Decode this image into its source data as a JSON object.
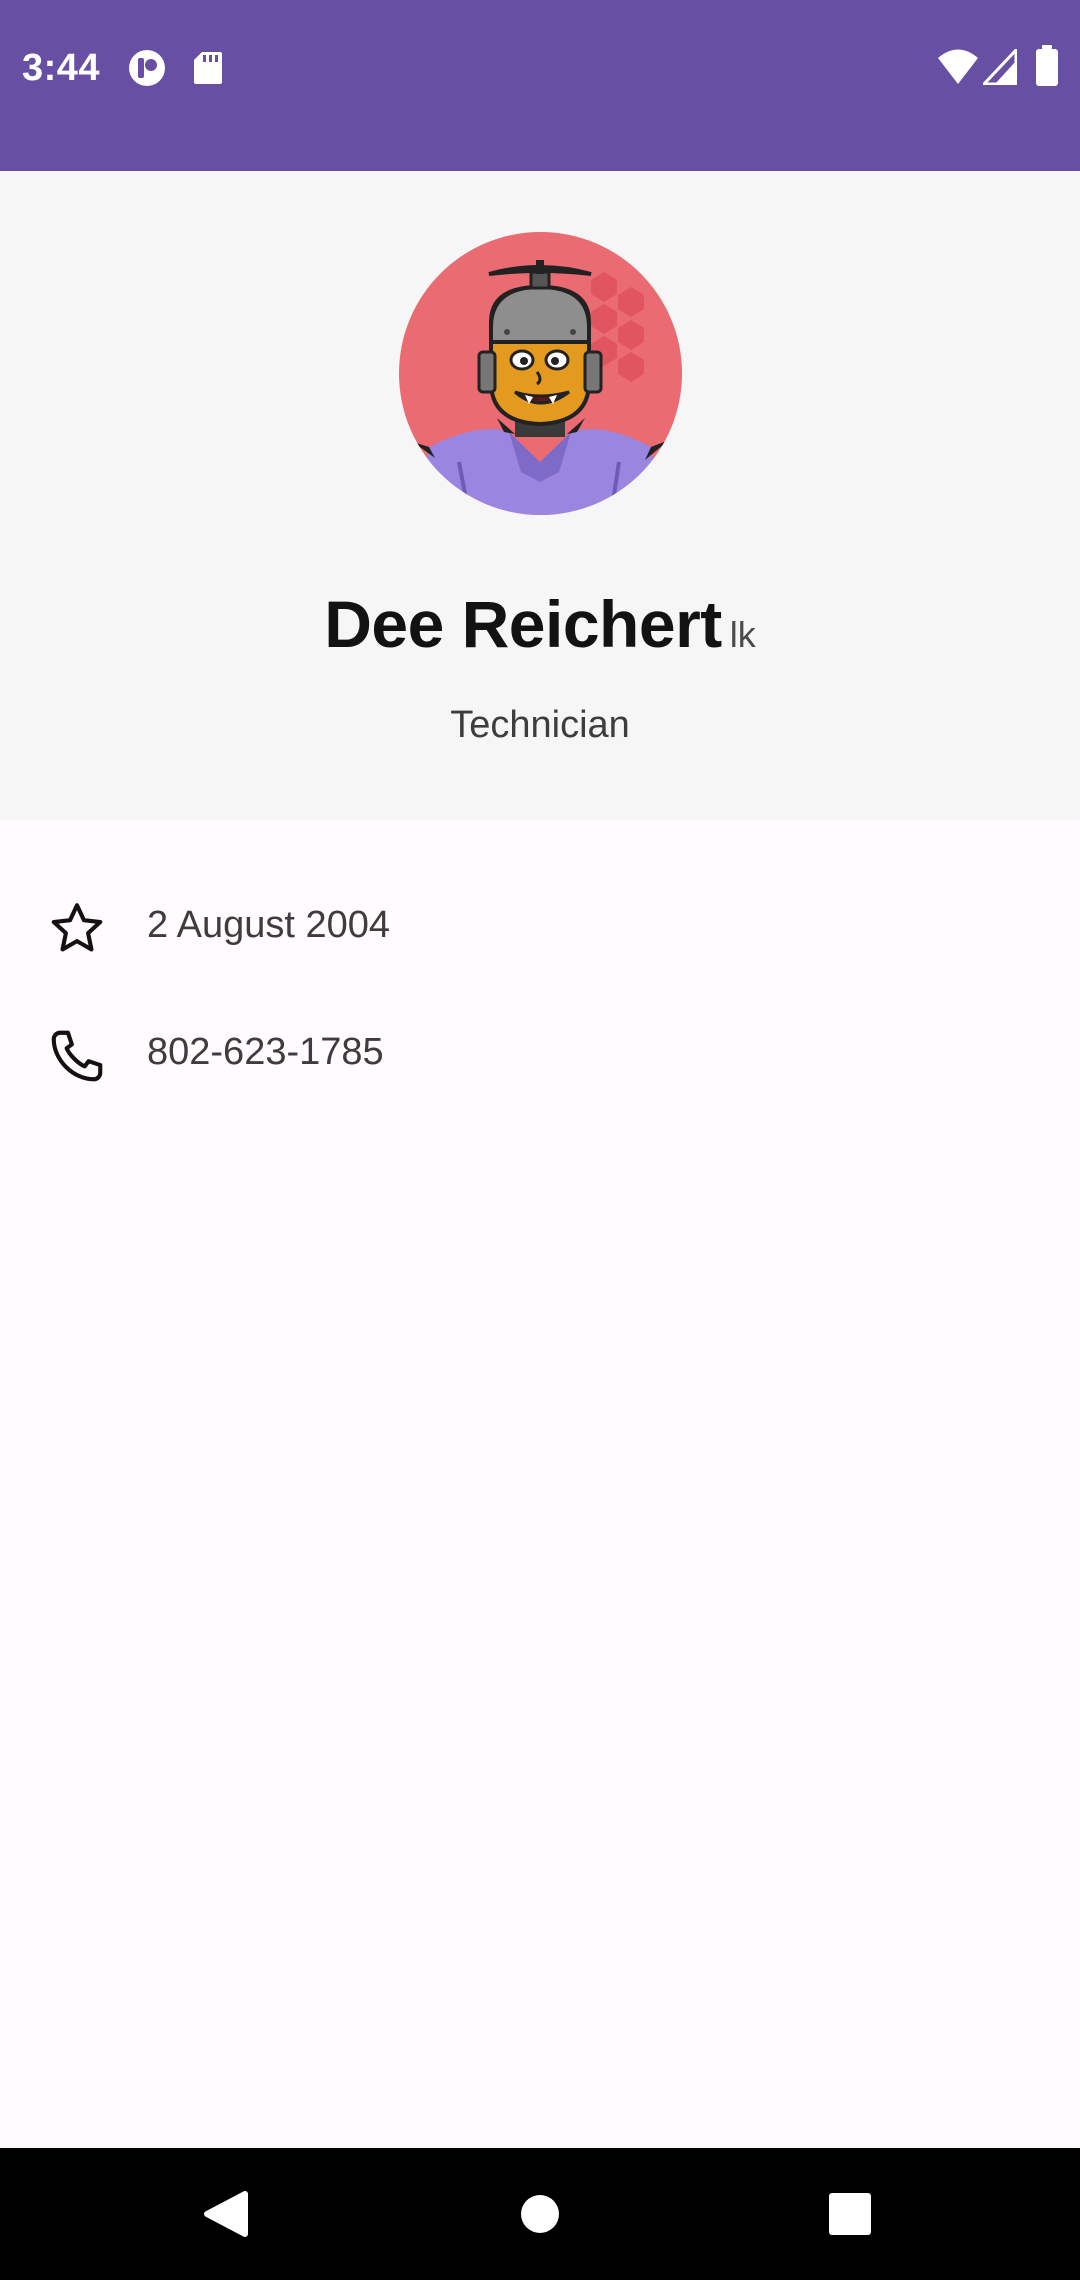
{
  "status_bar": {
    "time": "3:44",
    "icons": [
      "app-notification-icon",
      "sd-card-icon",
      "wifi-icon",
      "signal-icon",
      "battery-icon"
    ]
  },
  "profile": {
    "name": "Dee Reichert",
    "suffix": "lk",
    "job_title": "Technician",
    "avatar": "cartoon-robot-avatar"
  },
  "details": [
    {
      "icon": "star-icon",
      "value": "2 August 2004"
    },
    {
      "icon": "phone-icon",
      "value": "802-623-1785"
    }
  ],
  "navigation": {
    "buttons": [
      "back-button",
      "home-button",
      "recents-button"
    ]
  },
  "colors": {
    "status_bar": "#6750A4",
    "header_background": "#F6F6F6",
    "page_background": "#FFFBFE",
    "nav_bar": "#000000"
  }
}
